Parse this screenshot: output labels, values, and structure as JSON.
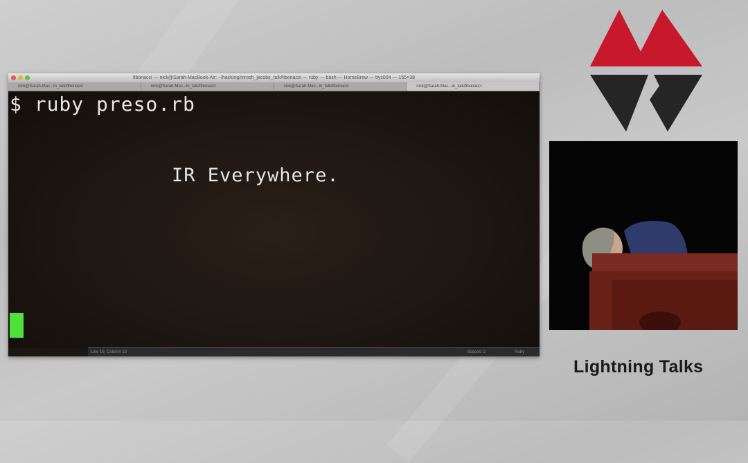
{
  "terminal": {
    "window_title": "fibonacci — nick@Sarah-MacBook-Air: ~/hacking/mrosh_jacobs_talk/fibonacci — ruby — bash — HomeBrew — ttys004 — 155×38",
    "tabs": [
      {
        "label": "nick@Sarah-Mac...in_talk/fibonacci",
        "active": false
      },
      {
        "label": "nick@Sarah-Mac...in_talk/fibonacci",
        "active": false
      },
      {
        "label": "nick@Sarah-Mac...in_talk/fibonacci",
        "active": false
      },
      {
        "label": "nick@Sarah-Mac...in_talk/fibonacci",
        "active": true
      }
    ],
    "prompt": "$ ruby preso.rb",
    "slide_text": "IR Everywhere.",
    "status_left": "Line 16, Column 13",
    "status_mid": "Spaces: 2",
    "status_right": "Ruby",
    "cursor_color": "#4fe03a"
  },
  "logo": {
    "name": "conference-logo",
    "top_color": "#c8182b",
    "bottom_color": "#252525"
  },
  "caption": "Lightning Talks"
}
